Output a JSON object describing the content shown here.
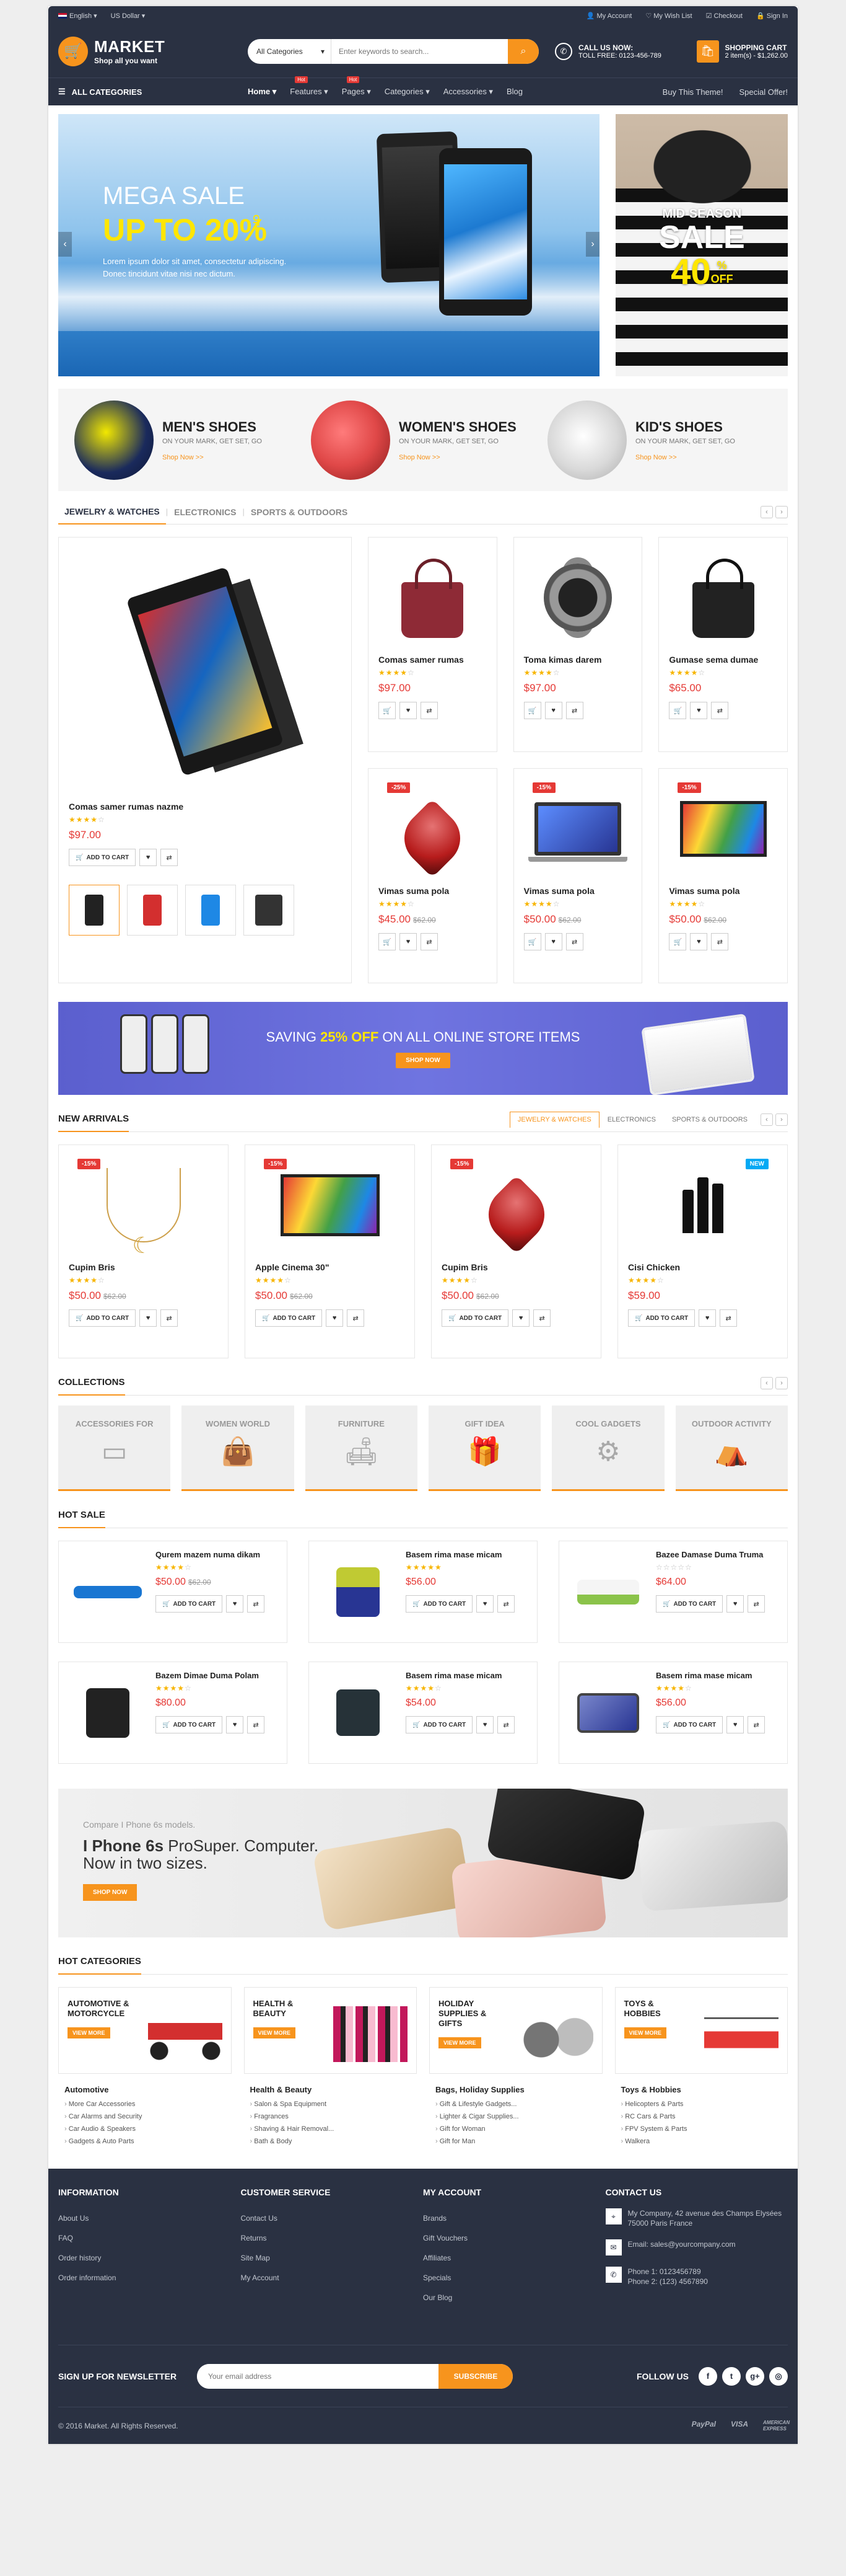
{
  "topbar": {
    "language": "English",
    "currency": "US Dollar",
    "links": [
      "My Account",
      "My Wish List",
      "Checkout",
      "Sign In"
    ]
  },
  "header": {
    "logo_title": "MARKET",
    "logo_tagline": "Shop all you want",
    "search_category": "All Categories",
    "search_placeholder": "Enter keywords to search...",
    "call_title": "CALL US NOW:",
    "call_number": "TOLL FREE: 0123-456-789",
    "cart_title": "SHOPPING CART",
    "cart_summary": "2 item(s) - $1,262.00"
  },
  "nav": {
    "all_categories": "ALL CATEGORIES",
    "items": [
      {
        "label": "Home ▾",
        "badge": ""
      },
      {
        "label": "Features ▾",
        "badge": "Hot"
      },
      {
        "label": "Pages ▾",
        "badge": "Hot"
      },
      {
        "label": "Categories ▾",
        "badge": ""
      },
      {
        "label": "Accessories ▾",
        "badge": ""
      },
      {
        "label": "Blog",
        "badge": ""
      }
    ],
    "right": [
      "Buy This Theme!",
      "Special Offer!"
    ]
  },
  "hero": {
    "mega": "MEGA SALE",
    "upto": "UP TO 20%",
    "off": "OFF",
    "desc": "Lorem ipsum dolor sit amet, consectetur adipiscing. Donec tincidunt vitae nisi nec dictum.",
    "side_a": "MID-SEASON",
    "side_b": "SALE",
    "side_c": "40",
    "side_c_pct": "%",
    "side_c_off": "OFF"
  },
  "shoes": [
    {
      "title": "MEN'S SHOES",
      "sub": "ON YOUR MARK, GET SET, GO",
      "link": "Shop Now >>",
      "color": "#f2e800"
    },
    {
      "title": "WOMEN'S SHOES",
      "sub": "ON YOUR MARK, GET SET, GO",
      "link": "Shop Now >>",
      "color": "#e04848"
    },
    {
      "title": "KID'S SHOES",
      "sub": "ON YOUR MARK, GET SET, GO",
      "link": "Shop Now >>",
      "color": "#d9d9d9"
    }
  ],
  "tabs1": [
    "JEWELRY & WATCHES",
    "ELECTRONICS",
    "SPORTS & OUTDOORS"
  ],
  "featured": {
    "name": "Comas samer rumas nazme",
    "price": "$97.00",
    "add_to_cart": "ADD TO CART"
  },
  "grid1": [
    {
      "name": "Comas samer rumas",
      "price": "$97.00",
      "old": "",
      "disc": ""
    },
    {
      "name": "Toma kimas darem",
      "price": "$97.00",
      "old": "",
      "disc": ""
    },
    {
      "name": "Gumase sema dumae",
      "price": "$65.00",
      "old": "",
      "disc": ""
    },
    {
      "name": "Vimas suma pola",
      "price": "$45.00",
      "old": "$62.00",
      "disc": "-25%"
    },
    {
      "name": "Vimas suma pola",
      "price": "$50.00",
      "old": "$62.00",
      "disc": "-15%"
    },
    {
      "name": "Vimas suma pola",
      "price": "$50.00",
      "old": "$62.00",
      "disc": "-15%"
    }
  ],
  "promo": {
    "pre": "SAVING ",
    "pct": "25% OFF",
    "post": " ON ALL ONLINE STORE ITEMS",
    "button": "SHOP NOW"
  },
  "arrivals": {
    "title": "NEW ARRIVALS",
    "tabs": [
      "JEWELRY & WATCHES",
      "ELECTRONICS",
      "SPORTS & OUTDOORS"
    ],
    "items": [
      {
        "name": "Cupim Bris",
        "price": "$50.00",
        "old": "$62.00",
        "disc": "-15%"
      },
      {
        "name": "Apple Cinema 30\"",
        "price": "$50.00",
        "old": "$62.00",
        "disc": "-15%"
      },
      {
        "name": "Cupim Bris",
        "price": "$50.00",
        "old": "$62.00",
        "disc": "-15%"
      },
      {
        "name": "Cisi Chicken",
        "price": "$59.00",
        "old": "",
        "disc": "NEW"
      }
    ]
  },
  "collections": {
    "title": "COLLECTIONS",
    "items": [
      {
        "label": "ACCESSORIES FOR",
        "icon": "▭"
      },
      {
        "label": "WOMEN WORLD",
        "icon": "👜"
      },
      {
        "label": "FURNITURE",
        "icon": "🛋"
      },
      {
        "label": "GIFT IDEA",
        "icon": "🎁"
      },
      {
        "label": "COOL GADGETS",
        "icon": "⚙"
      },
      {
        "label": "OUTDOOR ACTIVITY",
        "icon": "⛺"
      }
    ]
  },
  "hotsale": {
    "title": "HOT SALE",
    "items": [
      {
        "name": "Qurem mazem numa dikam",
        "price": "$50.00",
        "old": "$62.00",
        "color": "#1976d2"
      },
      {
        "name": "Basem rima mase micam",
        "price": "$56.00",
        "old": "",
        "color": "#283593"
      },
      {
        "name": "Bazee Damase Duma Truma",
        "price": "$64.00",
        "old": "",
        "color": "#8bc34a"
      },
      {
        "name": "Bazem Dimae Duma Polam",
        "price": "$80.00",
        "old": "",
        "color": "#222222"
      },
      {
        "name": "Basem rima mase micam",
        "price": "$54.00",
        "old": "",
        "color": "#263238"
      },
      {
        "name": "Basem rima mase micam",
        "price": "$56.00",
        "old": "",
        "color": "#444444"
      }
    ]
  },
  "iphone": {
    "a": "Compare I Phone 6s  models.",
    "b1": "I Phone 6s",
    "b2": " ProSuper. Computer.",
    "b3": "Now in two sizes.",
    "button": "SHOP NOW"
  },
  "hotcats": {
    "title": "HOT CATEGORIES",
    "view_more": "VIEW MORE",
    "items": [
      {
        "title": "AUTOMOTIVE & MOTORCYCLE",
        "head": "Automotive",
        "list": [
          "More Car Accessories",
          "Car Alarms and Security",
          "Car Audio & Speakers",
          "Gadgets & Auto Parts"
        ],
        "color": "#d32f2f"
      },
      {
        "title": "HEALTH & BEAUTY",
        "head": "Health & Beauty",
        "list": [
          "Salon & Spa Equipment",
          "Fragrances",
          "Shaving & Hair Removal...",
          "Bath & Body"
        ],
        "color": "#c2185b"
      },
      {
        "title": "HOLIDAY SUPPLIES & GIFTS",
        "head": "Bags, Holiday Supplies",
        "list": [
          "Gift & Lifestyle Gadgets...",
          "Lighter & Cigar Supplies...",
          "Gift for Woman",
          "Gift for Man"
        ],
        "color": "#757575"
      },
      {
        "title": "TOYS & HOBBIES",
        "head": "Toys & Hobbies",
        "list": [
          "Helicopters & Parts",
          "RC Cars & Parts",
          "FPV System & Parts",
          "Walkera"
        ],
        "color": "#e53935"
      }
    ]
  },
  "footer": {
    "cols": [
      {
        "title": "INFORMATION",
        "links": [
          "About Us",
          "FAQ",
          "Order history",
          "Order information"
        ]
      },
      {
        "title": "CUSTOMER SERVICE",
        "links": [
          "Contact Us",
          "Returns",
          "Site Map",
          "My Account"
        ]
      },
      {
        "title": "MY ACCOUNT",
        "links": [
          "Brands",
          "Gift Vouchers",
          "Affiliates",
          "Specials",
          "Our Blog"
        ]
      }
    ],
    "contact_title": "CONTACT US",
    "address": "My Company, 42 avenue des Champs Elysées 75000 Paris France",
    "email": "Email: sales@yourcompany.com",
    "phone1": "Phone 1: 0123456789",
    "phone2": "Phone 2: (123) 4567890",
    "newsletter": "SIGN UP FOR NEWSLETTER",
    "email_placeholder": "Your email address",
    "subscribe": "SUBSCRIBE",
    "follow": "FOLLOW US",
    "copyright": "© 2016 Market. All Rights Reserved.",
    "payments": [
      "PayPal",
      "VISA",
      "AMERICAN EXPRESS"
    ]
  },
  "colors": {
    "accent": "#f7941d",
    "dark": "#2a3142",
    "price": "#e53935"
  }
}
